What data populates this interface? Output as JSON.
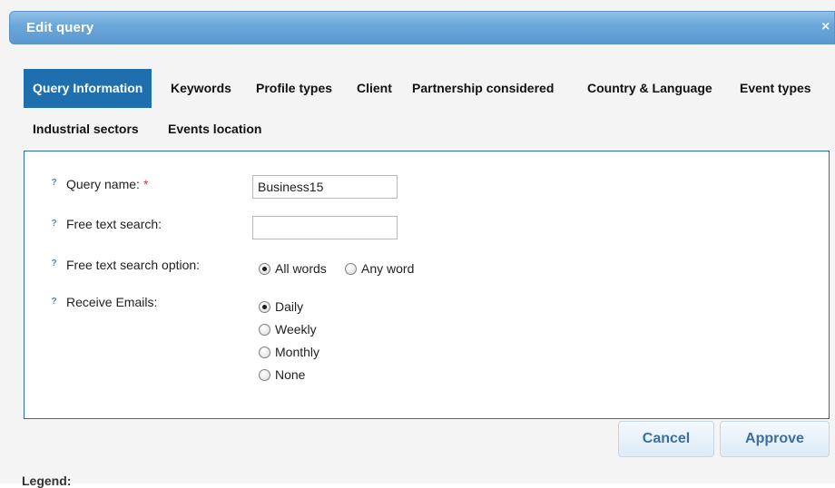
{
  "dialog": {
    "title": "Edit query",
    "close_symbol": "×"
  },
  "tabs": [
    {
      "label": "Query Information",
      "active": true
    },
    {
      "label": "Keywords"
    },
    {
      "label": "Profile types"
    },
    {
      "label": "Client"
    },
    {
      "label": "Partnership considered"
    },
    {
      "label": "Country & Language"
    },
    {
      "label": "Event types"
    },
    {
      "label": "Industrial sectors"
    },
    {
      "label": "Events location"
    }
  ],
  "form": {
    "help_symbol": "?",
    "query_name": {
      "label": "Query name:",
      "required_mark": "*",
      "value": "Business15"
    },
    "free_text": {
      "label": "Free text search:",
      "value": ""
    },
    "free_text_option": {
      "label": "Free text search option:",
      "options": [
        {
          "label": "All words",
          "checked": true
        },
        {
          "label": "Any word",
          "checked": false
        }
      ]
    },
    "receive_emails": {
      "label": "Receive Emails:",
      "options": [
        {
          "label": "Daily",
          "checked": true
        },
        {
          "label": "Weekly",
          "checked": false
        },
        {
          "label": "Monthly",
          "checked": false
        },
        {
          "label": "None",
          "checked": false
        }
      ]
    }
  },
  "buttons": {
    "cancel": "Cancel",
    "approve": "Approve"
  },
  "legend": {
    "label": "Legend:"
  },
  "colors": {
    "title_bar": "#6aa6d9",
    "active_tab": "#1f6fae",
    "panel_border": "#2a6fa8",
    "required": "#d9342b"
  }
}
